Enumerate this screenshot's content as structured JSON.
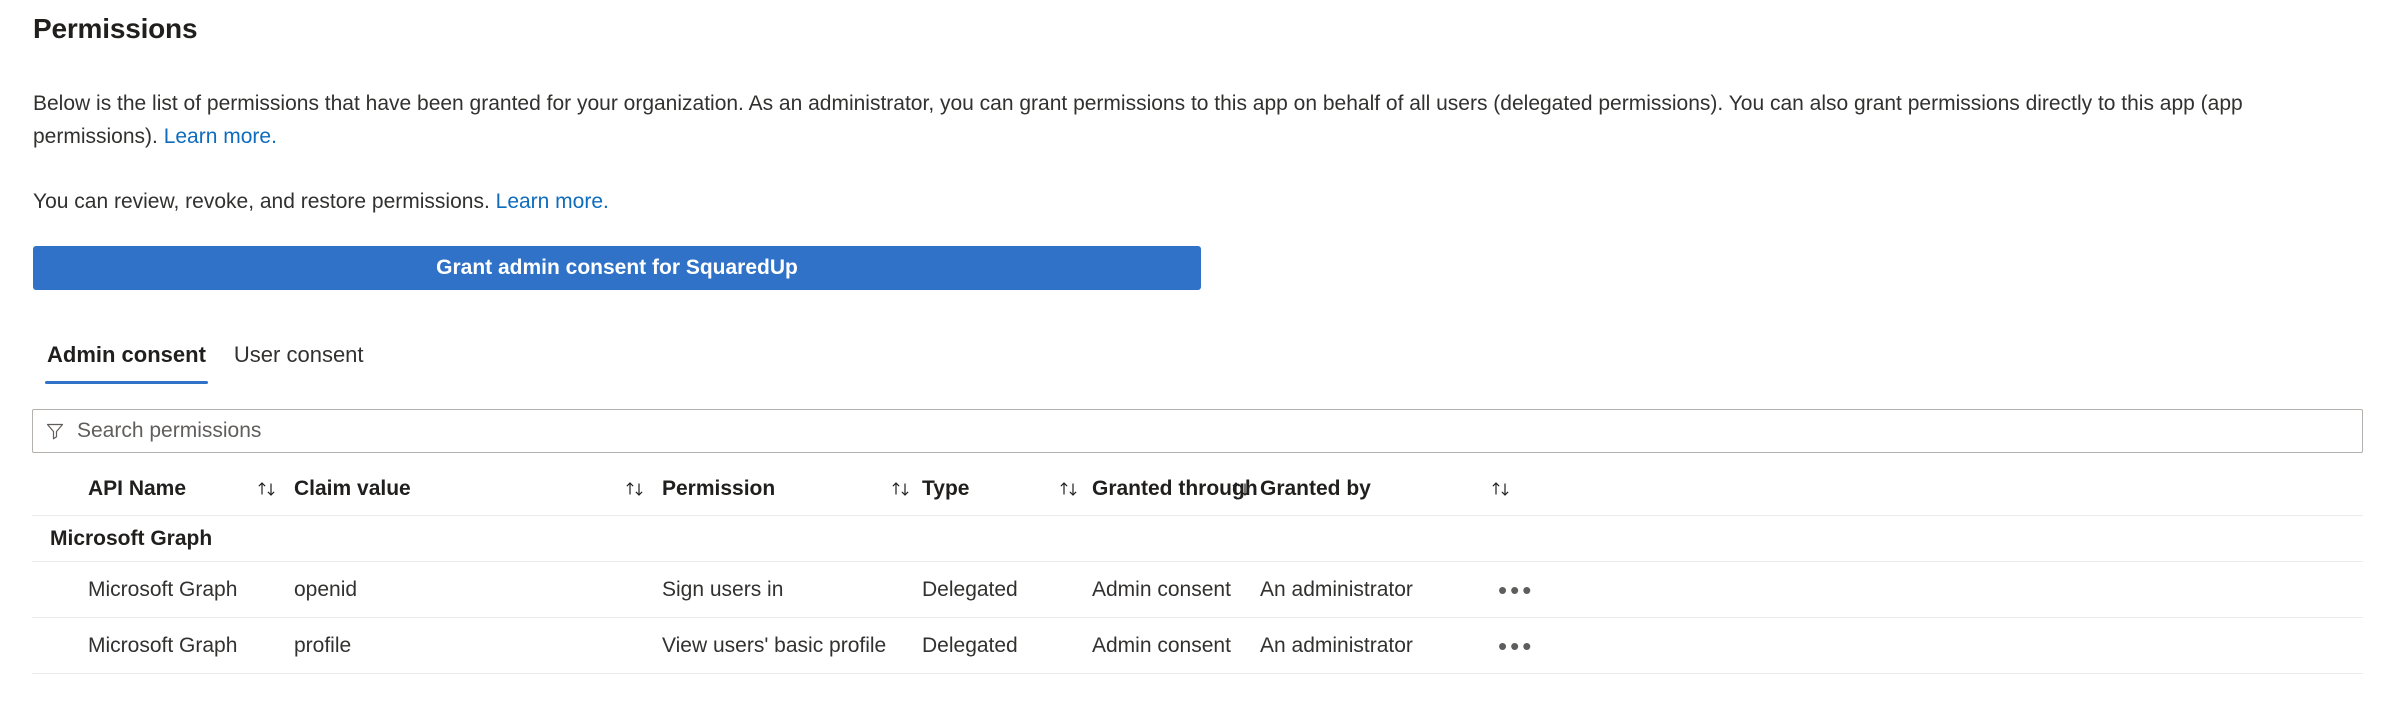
{
  "header": {
    "title": "Permissions"
  },
  "intro": {
    "paragraph1_before_link": "Below is the list of permissions that have been granted for your organization. As an administrator, you can grant permissions to this app on behalf of all users (delegated permissions). You can also grant permissions directly to this app (app permissions). ",
    "paragraph1_link": "Learn more.",
    "paragraph2_before_link": "You can review, revoke, and restore permissions. ",
    "paragraph2_link": "Learn more."
  },
  "actions": {
    "grant_consent_label": "Grant admin consent for SquaredUp"
  },
  "tabs": [
    {
      "label": "Admin consent",
      "active": true
    },
    {
      "label": "User consent",
      "active": false
    }
  ],
  "search": {
    "placeholder": "Search permissions",
    "value": "",
    "icon": "filter-icon"
  },
  "table": {
    "columns": [
      {
        "key": "api_name",
        "label": "API Name",
        "sortable": true
      },
      {
        "key": "claim_value",
        "label": "Claim value",
        "sortable": true
      },
      {
        "key": "permission",
        "label": "Permission",
        "sortable": true
      },
      {
        "key": "type",
        "label": "Type",
        "sortable": true
      },
      {
        "key": "granted_through",
        "label": "Granted through",
        "sortable": true
      },
      {
        "key": "granted_by",
        "label": "Granted by",
        "sortable": true
      }
    ],
    "groups": [
      {
        "label": "Microsoft Graph",
        "rows": [
          {
            "api_name": "Microsoft Graph",
            "claim_value": "openid",
            "permission": "Sign users in",
            "type": "Delegated",
            "granted_through": "Admin consent",
            "granted_by": "An administrator",
            "more_label": "•••"
          },
          {
            "api_name": "Microsoft Graph",
            "claim_value": "profile",
            "permission": "View users' basic profile",
            "type": "Delegated",
            "granted_through": "Admin consent",
            "granted_by": "An administrator",
            "more_label": "•••"
          }
        ]
      }
    ]
  },
  "colors": {
    "accent": "#2f72c8",
    "link": "#0f6cbd",
    "text": "#323130",
    "border": "#edebe9"
  }
}
